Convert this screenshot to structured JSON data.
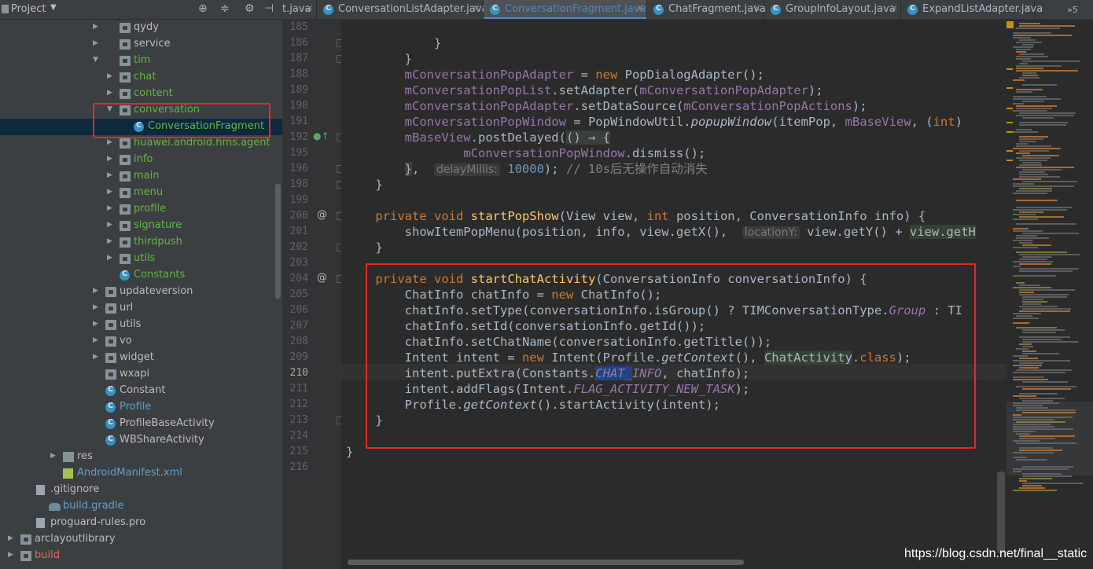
{
  "project_panel": {
    "title": "Project",
    "tree": [
      {
        "label": "qydy",
        "kind": "folder",
        "expanded": false
      },
      {
        "label": "service",
        "kind": "folder",
        "expanded": false
      },
      {
        "label": "tim",
        "kind": "folder",
        "expanded": true,
        "color": "green"
      },
      {
        "label": "chat",
        "kind": "folder",
        "expanded": false,
        "color": "green"
      },
      {
        "label": "content",
        "kind": "folder",
        "expanded": false,
        "color": "green"
      },
      {
        "label": "conversation",
        "kind": "folder",
        "expanded": true,
        "color": "green"
      },
      {
        "label": "ConversationFragment",
        "kind": "class",
        "color": "green",
        "selected": true
      },
      {
        "label": "huawei.android.hms.agent",
        "kind": "folder",
        "expanded": false,
        "color": "green"
      },
      {
        "label": "info",
        "kind": "folder",
        "expanded": false,
        "color": "green"
      },
      {
        "label": "main",
        "kind": "folder",
        "expanded": false,
        "color": "green"
      },
      {
        "label": "menu",
        "kind": "folder",
        "expanded": false,
        "color": "green"
      },
      {
        "label": "profile",
        "kind": "folder",
        "expanded": false,
        "color": "green"
      },
      {
        "label": "signature",
        "kind": "folder",
        "expanded": false,
        "color": "green"
      },
      {
        "label": "thirdpush",
        "kind": "folder",
        "expanded": false,
        "color": "green"
      },
      {
        "label": "utils",
        "kind": "folder",
        "expanded": false,
        "color": "green"
      },
      {
        "label": "Constants",
        "kind": "class",
        "color": "green"
      },
      {
        "label": "updateversion",
        "kind": "folder",
        "expanded": false
      },
      {
        "label": "url",
        "kind": "folder",
        "expanded": false
      },
      {
        "label": "utils",
        "kind": "folder",
        "expanded": false
      },
      {
        "label": "vo",
        "kind": "folder",
        "expanded": false
      },
      {
        "label": "widget",
        "kind": "folder",
        "expanded": false
      },
      {
        "label": "wxapi",
        "kind": "folder",
        "expanded": false,
        "no_arrow": true
      },
      {
        "label": "Constant",
        "kind": "class"
      },
      {
        "label": "Profile",
        "kind": "class",
        "color": "blue"
      },
      {
        "label": "ProfileBaseActivity",
        "kind": "class"
      },
      {
        "label": "WBShareActivity",
        "kind": "class"
      },
      {
        "label": "res",
        "kind": "res-folder",
        "expanded": false
      },
      {
        "label": "AndroidManifest.xml",
        "kind": "manifest",
        "color": "blue"
      },
      {
        "label": ".gitignore",
        "kind": "file"
      },
      {
        "label": "build.gradle",
        "kind": "gradle",
        "color": "blue"
      },
      {
        "label": "proguard-rules.pro",
        "kind": "file"
      },
      {
        "label": "arclayoutlibrary",
        "kind": "folder",
        "expanded": false
      },
      {
        "label": "build",
        "kind": "folder",
        "expanded": false,
        "color": "red"
      }
    ]
  },
  "tabs": [
    {
      "label": "t.java",
      "active": false
    },
    {
      "label": "ConversationListAdapter.java",
      "active": false
    },
    {
      "label": "ConversationFragment.java",
      "active": true
    },
    {
      "label": "ChatFragment.java",
      "active": false
    },
    {
      "label": "GroupInfoLayout.java",
      "active": false
    },
    {
      "label": "ExpandListAdapter.java",
      "active": false
    }
  ],
  "tabs_overflow": "»5",
  "editor": {
    "line_numbers": [
      "185",
      "186",
      "187",
      "188",
      "189",
      "190",
      "191",
      "192",
      "195",
      "196",
      "198",
      "199",
      "200",
      "201",
      "202",
      "203",
      "204",
      "205",
      "206",
      "207",
      "208",
      "209",
      "210",
      "211",
      "212",
      "213",
      "214",
      "215",
      "216"
    ],
    "current_line": "210",
    "lines": [
      [
        {
          "t": ""
        }
      ],
      [
        {
          "t": "            }"
        }
      ],
      [
        {
          "t": "        }"
        }
      ],
      [
        {
          "t": "        "
        },
        {
          "t": "mConversationPopAdapter",
          "c": "f"
        },
        {
          "t": " = "
        },
        {
          "t": "new",
          "c": "k"
        },
        {
          "t": " PopDialogAdapter();"
        }
      ],
      [
        {
          "t": "        "
        },
        {
          "t": "mConversationPopList",
          "c": "f"
        },
        {
          "t": ".setAdapter("
        },
        {
          "t": "mConversationPopAdapter",
          "c": "f"
        },
        {
          "t": ");"
        }
      ],
      [
        {
          "t": "        "
        },
        {
          "t": "mConversationPopAdapter",
          "c": "f"
        },
        {
          "t": ".setDataSource("
        },
        {
          "t": "mConversationPopActions",
          "c": "f"
        },
        {
          "t": ");"
        }
      ],
      [
        {
          "t": "        "
        },
        {
          "t": "mConversationPopWindow",
          "c": "f"
        },
        {
          "t": " = PopWindowUtil."
        },
        {
          "t": "popupWindow",
          "c": "it"
        },
        {
          "t": "(itemPop, "
        },
        {
          "t": "mBaseView",
          "c": "f"
        },
        {
          "t": ", ("
        },
        {
          "t": "int",
          "c": "k"
        },
        {
          "t": ")"
        }
      ],
      [
        {
          "t": "        "
        },
        {
          "t": "mBaseView",
          "c": "f"
        },
        {
          "t": ".postDelayed("
        },
        {
          "t": "() → {",
          "c": "lam"
        }
      ],
      [
        {
          "t": "                "
        },
        {
          "t": "mConversationPopWindow",
          "c": "f"
        },
        {
          "t": ".dismiss();"
        }
      ],
      [
        {
          "t": "        "
        },
        {
          "t": "}",
          "c": "lam"
        },
        {
          "t": ",  "
        },
        {
          "t": "delayMillis:",
          "c": "hint"
        },
        {
          "t": " "
        },
        {
          "t": "10000",
          "c": "n"
        },
        {
          "t": "); "
        },
        {
          "t": "// 10s后无操作自动消失",
          "c": "c"
        }
      ],
      [
        {
          "t": "    }"
        }
      ],
      [
        {
          "t": ""
        }
      ],
      [
        {
          "t": "    "
        },
        {
          "t": "private void ",
          "c": "k"
        },
        {
          "t": "startPopShow",
          "c": "m"
        },
        {
          "t": "(View view, "
        },
        {
          "t": "int",
          "c": "k"
        },
        {
          "t": " position, ConversationInfo info) {"
        }
      ],
      [
        {
          "t": "        showItemPopMenu(position, info, view.getX(),  "
        },
        {
          "t": "locationY:",
          "c": "hint"
        },
        {
          "t": " view.getY() + "
        },
        {
          "t": "view.getH",
          "c": "hlbox"
        }
      ],
      [
        {
          "t": "    }"
        }
      ],
      [
        {
          "t": ""
        }
      ],
      [
        {
          "t": "    "
        },
        {
          "t": "private void ",
          "c": "k"
        },
        {
          "t": "startChatActivity",
          "c": "m"
        },
        {
          "t": "(ConversationInfo conversationInfo) {"
        }
      ],
      [
        {
          "t": "        ChatInfo chatInfo = "
        },
        {
          "t": "new",
          "c": "k"
        },
        {
          "t": " ChatInfo();"
        }
      ],
      [
        {
          "t": "        chatInfo.setType(conversationInfo.isGroup() ? TIMConversationType."
        },
        {
          "t": "Group",
          "c": "fi"
        },
        {
          "t": " : TI"
        }
      ],
      [
        {
          "t": "        chatInfo.setId(conversationInfo.getId());"
        }
      ],
      [
        {
          "t": "        chatInfo.setChatName(conversationInfo.getTitle());"
        }
      ],
      [
        {
          "t": "        Intent intent = "
        },
        {
          "t": "new",
          "c": "k"
        },
        {
          "t": " Intent(Profile."
        },
        {
          "t": "getContext",
          "c": "it"
        },
        {
          "t": "(), "
        },
        {
          "t": "ChatActivity",
          "c": "hlbox"
        },
        {
          "t": "."
        },
        {
          "t": "class",
          "c": "k"
        },
        {
          "t": ");"
        }
      ],
      [
        {
          "t": "        intent.putExtra(Constants."
        },
        {
          "t": "CHAT_",
          "c": "sel"
        },
        {
          "t": "INFO",
          "c": "fi"
        },
        {
          "t": ", chatInfo);"
        }
      ],
      [
        {
          "t": "        intent.addFlags(Intent."
        },
        {
          "t": "FLAG_ACTIVITY_NEW_TASK",
          "c": "fi"
        },
        {
          "t": ");"
        }
      ],
      [
        {
          "t": "        Profile."
        },
        {
          "t": "getContext",
          "c": "it"
        },
        {
          "t": "().startActivity(intent);"
        }
      ],
      [
        {
          "t": "    }"
        }
      ],
      [
        {
          "t": ""
        }
      ],
      [
        {
          "t": "}"
        }
      ],
      [
        {
          "t": ""
        }
      ]
    ]
  },
  "watermark": "https://blog.csdn.net/final__static",
  "colors": {
    "highlight_box": "#e8281f",
    "active_tab": "#4a88c7"
  }
}
